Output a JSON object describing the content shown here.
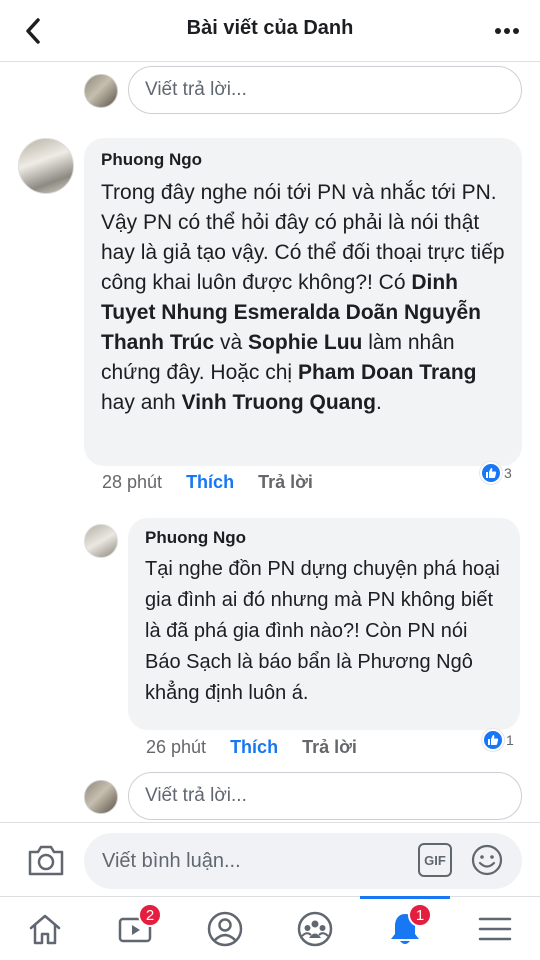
{
  "header": {
    "title": "Bài viết của Danh"
  },
  "reply_top": {
    "placeholder": "Viết trả lời..."
  },
  "comment1": {
    "author": "Phuong Ngo",
    "parts": [
      "Trong đây nghe nói tới PN và nhắc tới PN.",
      "Vậy PN có thể hỏi đây có phải là nói thật hay là giả tạo vậy. Có thể đối thoại trực tiếp công khai luôn được không?! Có ",
      "Dinh Tuyet Nhung Esmeralda",
      " ",
      "Doãn Nguyễn Thanh Trúc",
      " và ",
      "Sophie Luu",
      " làm nhân chứng đây. Hoặc chị ",
      "Pham Doan Trang",
      " hay anh ",
      "Vinh Truong Quang",
      "."
    ],
    "time": "28 phút",
    "like": "Thích",
    "reply": "Trả lời",
    "reaction_count": "3"
  },
  "comment2": {
    "author": "Phuong Ngo",
    "text": "Tại nghe đồn PN dựng chuyện phá hoại gia đình ai đó nhưng mà PN không biết là đã phá gia đình nào?! Còn PN nói Báo Sạch là báo bẩn là Phương Ngô khẳng định luôn á.",
    "time": "26 phút",
    "like": "Thích",
    "reply": "Trả lời",
    "reaction_count": "1"
  },
  "reply_bottom": {
    "placeholder": "Viết trả lời..."
  },
  "composer": {
    "placeholder": "Viết bình luận...",
    "gif_label": "GIF"
  },
  "tabbar": {
    "watch_badge": "2",
    "notifications_badge": "1",
    "active_tab": "notifications",
    "accent": "#1877f2",
    "badge_color": "#e41e3f"
  }
}
